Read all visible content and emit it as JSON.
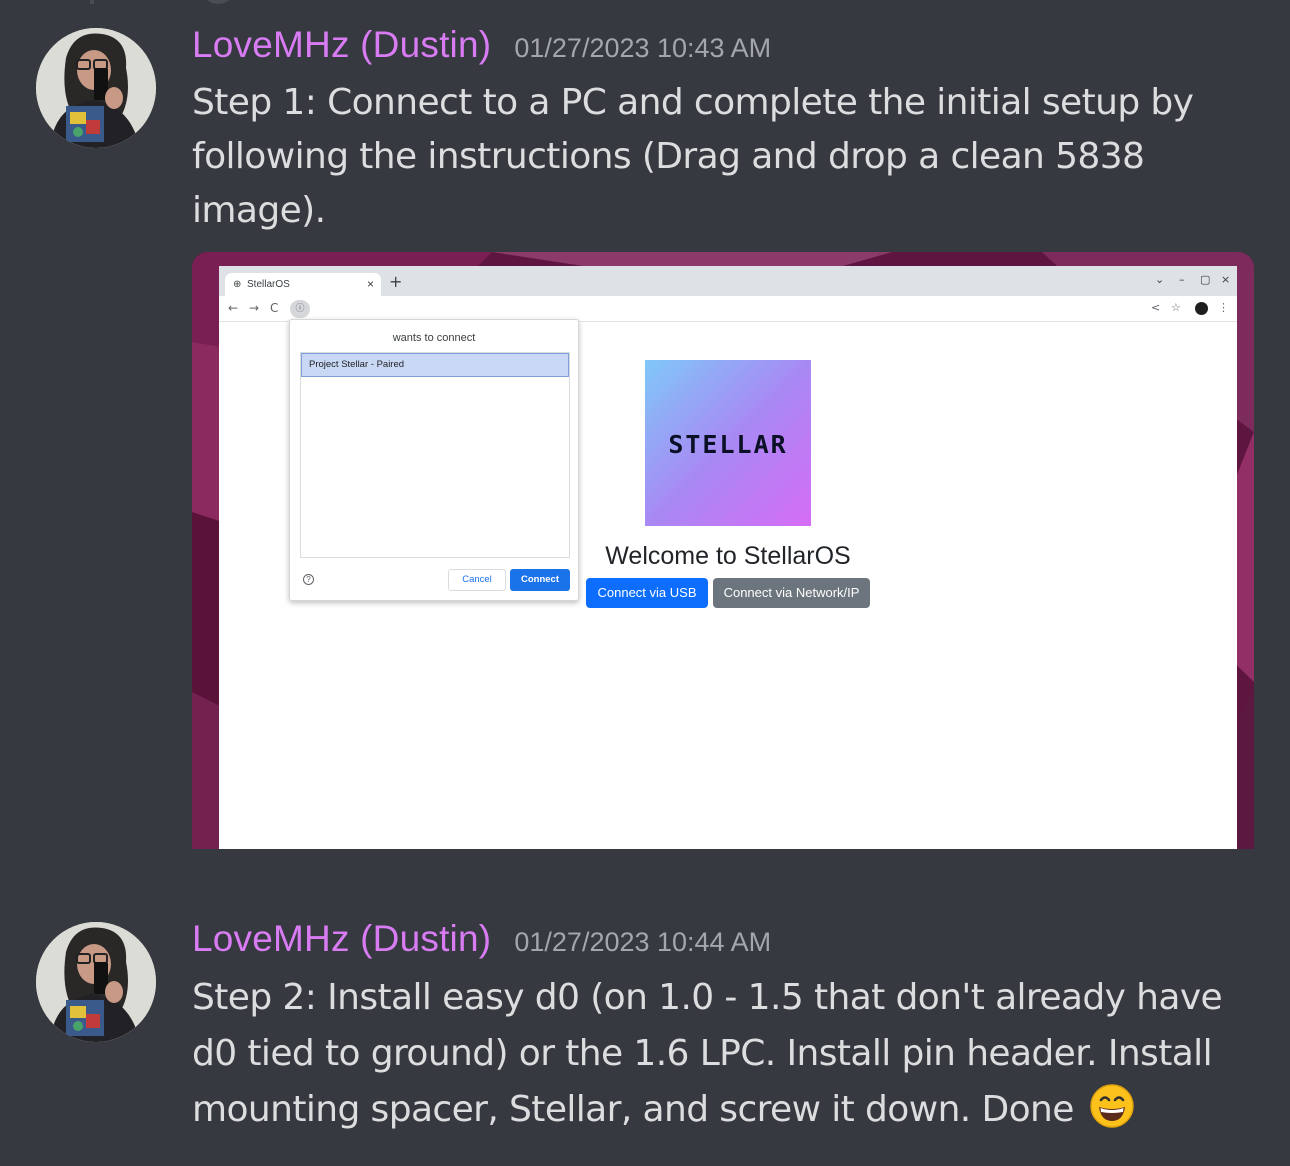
{
  "messages": [
    {
      "username": "LoveMHz (Dustin)",
      "timestamp": "01/27/2023 10:43 AM",
      "text": "Step 1: Connect to a PC and complete the initial setup by following the instructions (Drag and drop a clean 5838 image)."
    },
    {
      "username": "LoveMHz (Dustin)",
      "timestamp": "01/27/2023 10:44 AM",
      "text": "Step 2: Install easy d0 (on 1.0 - 1.5 that don't already have d0 tied to ground) or the 1.6 LPC. Install pin header. Install mounting spacer, Stellar, and screw it down. Done",
      "emoji": "grinning-face-with-smiling-eyes"
    }
  ],
  "screenshot": {
    "tab_title": "StellarOS",
    "tab_close": "×",
    "new_tab": "+",
    "window_controls": [
      "⌄",
      "–",
      "▢",
      "×"
    ],
    "nav": {
      "back": "←",
      "forward": "→",
      "reload": "C",
      "site_info": "ⓘ"
    },
    "toolbar_icons": [
      "<",
      "☆",
      "⋮"
    ],
    "dialog": {
      "title": "wants to connect",
      "device": "Project Stellar - Paired",
      "help": "?",
      "cancel": "Cancel",
      "connect": "Connect"
    },
    "logo_text": "STELLAR",
    "welcome": "Welcome to StellarOS",
    "buttons": {
      "usb": "Connect via USB",
      "network": "Connect via Network/IP"
    }
  },
  "colors": {
    "background": "#36393f",
    "username": "#d97cf4",
    "timestamp": "#a3a6aa",
    "message_text": "#dcddde",
    "usb_button": "#0d6efd",
    "network_button": "#6c757d"
  }
}
